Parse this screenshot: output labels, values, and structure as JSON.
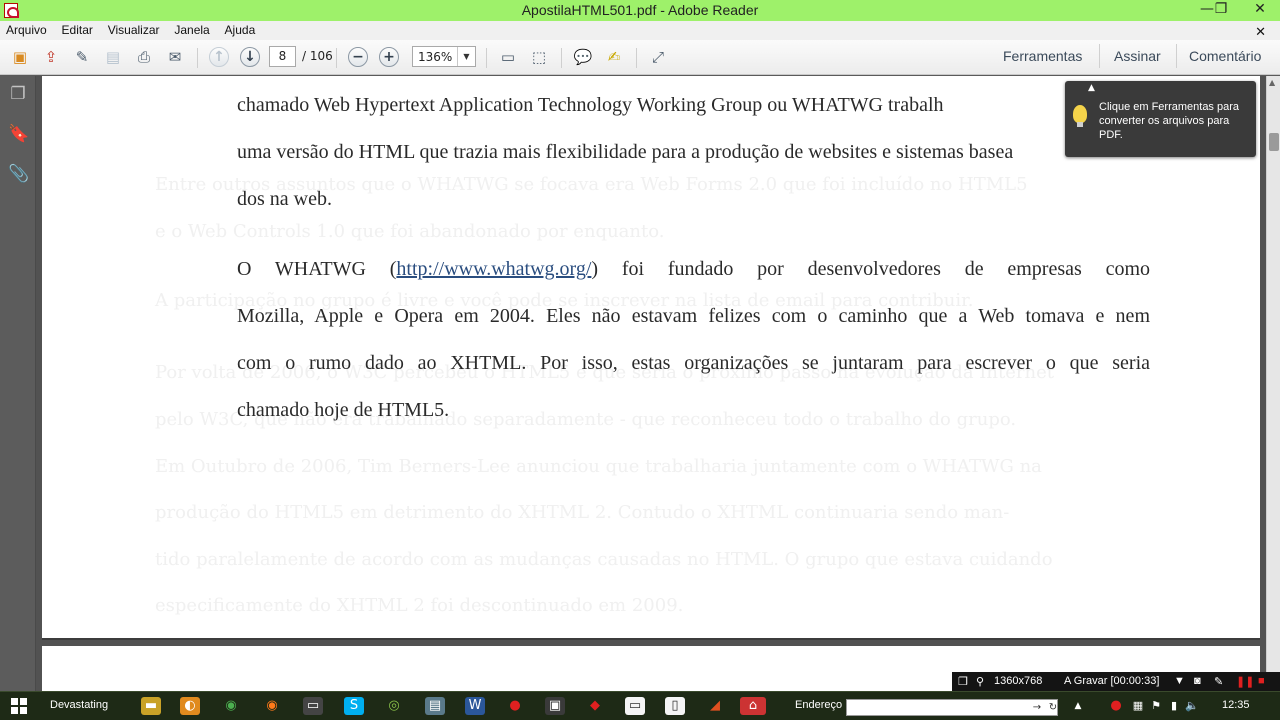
{
  "window": {
    "title": "ApostilaHTML501.pdf - Adobe Reader",
    "minimize_glyph": "—",
    "restore_glyph": "❐",
    "close_glyph": "✕"
  },
  "menu": {
    "items": [
      "Arquivo",
      "Editar",
      "Visualizar",
      "Janela",
      "Ajuda"
    ],
    "close_glyph": "✕"
  },
  "toolbar": {
    "current_page": "8",
    "total_pages": "/ 106",
    "zoom": "136%",
    "zoom_dropdown_glyph": "▼",
    "right_links": [
      "Ferramentas",
      "Assinar",
      "Comentário"
    ],
    "icons": [
      "create-pdf-icon",
      "export-icon",
      "edit-icon",
      "save-icon",
      "print-icon",
      "email-icon",
      "previous-page-icon",
      "next-page-icon",
      "zoom-out-icon",
      "zoom-in-icon",
      "fit-page-icon",
      "fit-width-icon",
      "comment-icon",
      "highlight-icon",
      "fullscreen-icon"
    ]
  },
  "tooltip": {
    "text": "Clique em Ferramentas para converter os arquivos para PDF."
  },
  "document": {
    "paragraph1_lines": [
      "chamado Web Hypertext Application Technology Working Group ou WHATWG trabalh",
      "uma versão do HTML que trazia mais flexibilidade para a produção de websites e sistemas basea",
      "dos na web."
    ],
    "paragraph2": {
      "line1_before": "O WHATWG (",
      "link": "http://www.whatwg.org/",
      "line1_after": ") foi fundado por desenvolvedores de empresas como",
      "lines": [
        "Mozilla, Apple e Opera em 2004. Eles não estavam felizes com o caminho que a Web tomava e nem",
        "com o rumo dado ao XHTML. Por isso, estas organizações se juntaram para escrever o que seria",
        "chamado hoje de HTML5."
      ]
    },
    "faded_lines": [
      "Entre outros assuntos que o WHATWG se focava era Web Forms 2.0 que foi incluído no HTML5",
      "e o Web Controls 1.0 que foi abandonado por enquanto.",
      "A participação no grupo é livre e você pode se inscrever na lista de email para contribuir.",
      "Por volta de 2006, o W3C percebeu o HTML5 e que seria o próximo passo na evolução da Internet",
      "pelo W3C, que não era trabalhado separadamente - que reconheceu todo o trabalho do grupo.",
      "Em Outubro de 2006, Tim Berners-Lee anunciou que trabalharia juntamente com o WHATWG na",
      "produção do HTML5 em detrimento do XHTML 2. Contudo o XHTML continuaria sendo man-",
      "tido paralelamente de acordo com as mudanças causadas no HTML. O grupo que estava cuidando",
      "especificamente do XHTML 2 foi descontinuado em 2009."
    ]
  },
  "recording": {
    "resolution": "1360x768",
    "status": "A Gravar [00:00:33]"
  },
  "taskbar": {
    "active_label": "Devastating",
    "address_label": "Endereço",
    "time": "12:35"
  },
  "colors": {
    "title_bar": "#9ef16a",
    "document_background": "#525252",
    "link": "#2a4d7f"
  }
}
